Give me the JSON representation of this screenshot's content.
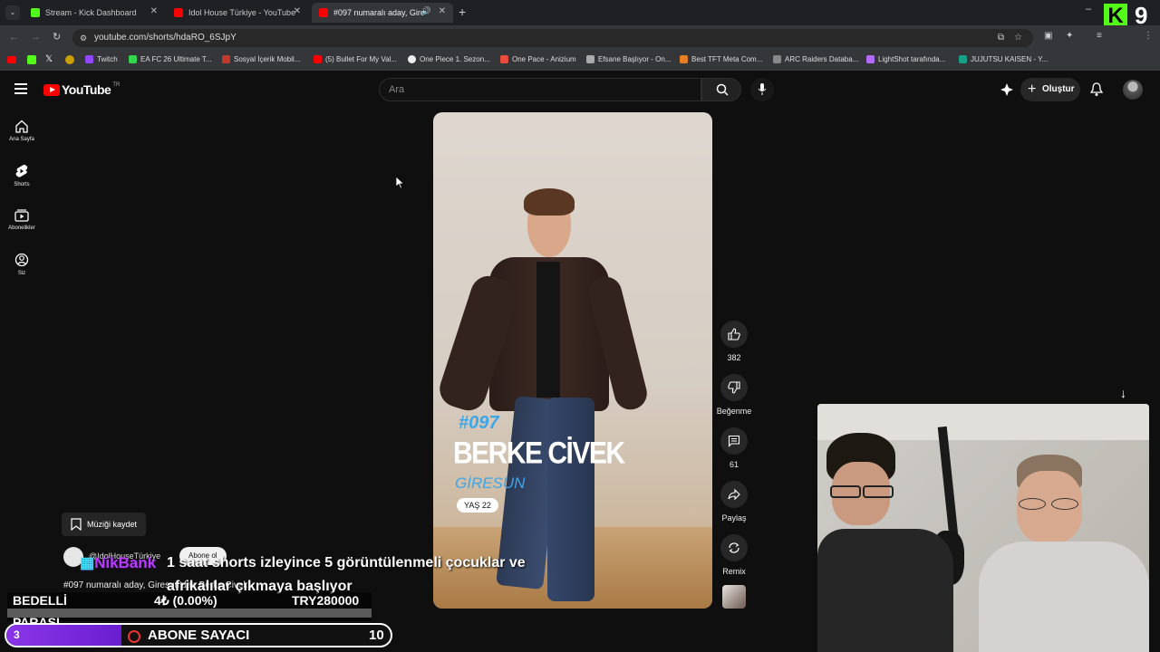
{
  "browser": {
    "tabs": [
      {
        "label": "Stream - Kick Dashboard",
        "color": "#53fc18"
      },
      {
        "label": "Idol House Türkiye - YouTube",
        "color": "#ff0000"
      },
      {
        "label": "#097 numaralı aday, Giresu",
        "color": "#ff0000"
      }
    ],
    "url": "youtube.com/shorts/hdaRO_6SJpY",
    "bookmarks": [
      {
        "label": "Twitch",
        "color": "#9146ff"
      },
      {
        "label": "EA FC 26 Ultimate T...",
        "color": "#32d74b"
      },
      {
        "label": "Sosyal İçerik Mobil...",
        "color": "#c0392b"
      },
      {
        "label": "(5) Bullet For My Val...",
        "color": "#ff0000"
      },
      {
        "label": "One Piece 1. Sezon...",
        "color": "#eeeeee"
      },
      {
        "label": "One Pace - Anizium",
        "color": "#e74c3c"
      },
      {
        "label": "Efsane Başlıyor - On...",
        "color": "#aaaaaa"
      },
      {
        "label": "Best TFT Meta Com...",
        "color": "#e67e22"
      },
      {
        "label": "ARC Raiders Databa...",
        "color": "#888888"
      },
      {
        "label": "LightShot tarafında...",
        "color": "#b36bff"
      },
      {
        "label": "JUJUTSU KAISEN - Y...",
        "color": "#16a085"
      }
    ],
    "kick_badge": "9"
  },
  "youtube": {
    "logo": "YouTube",
    "region": "TR",
    "search_placeholder": "Ara",
    "create_label": "Oluştur",
    "nav": [
      {
        "label": "Ana Sayfa",
        "icon": "home-icon"
      },
      {
        "label": "Shorts",
        "icon": "shorts-icon"
      },
      {
        "label": "Abonelikler",
        "icon": "subscriptions-icon"
      },
      {
        "label": "Siz",
        "icon": "you-icon"
      }
    ],
    "video": {
      "number": "#097",
      "name": "BERKE CİVEK",
      "city": "GİRESUN",
      "age": "YAŞ 22"
    },
    "actions": {
      "likes": "382",
      "dislike_label": "Beğenme",
      "comments": "61",
      "share_label": "Paylaş",
      "remix_label": "Remix"
    },
    "save_music": "Müziği kaydet",
    "channel": "@IdolHouseTürkiye",
    "subscribe": "Abone ol",
    "title": "#097 numaralı aday, Giresun'dan Berke Civek"
  },
  "stream_overlay": {
    "brand": "NikBank",
    "ticker_line1": "1 saat shorts izleyince 5 görüntülenmeli çocuklar ve",
    "ticker_line2": "afrikalılar çıkmaya başlıyor",
    "bedelli_label": "BEDELLİ",
    "parasi_label": "PARASI",
    "amount": "4₺ (0.00%)",
    "goal": "TRY280000",
    "abone_current": "3",
    "abone_label": "ABONE SAYACI",
    "abone_goal": "10",
    "abone_progress": 0.3
  }
}
